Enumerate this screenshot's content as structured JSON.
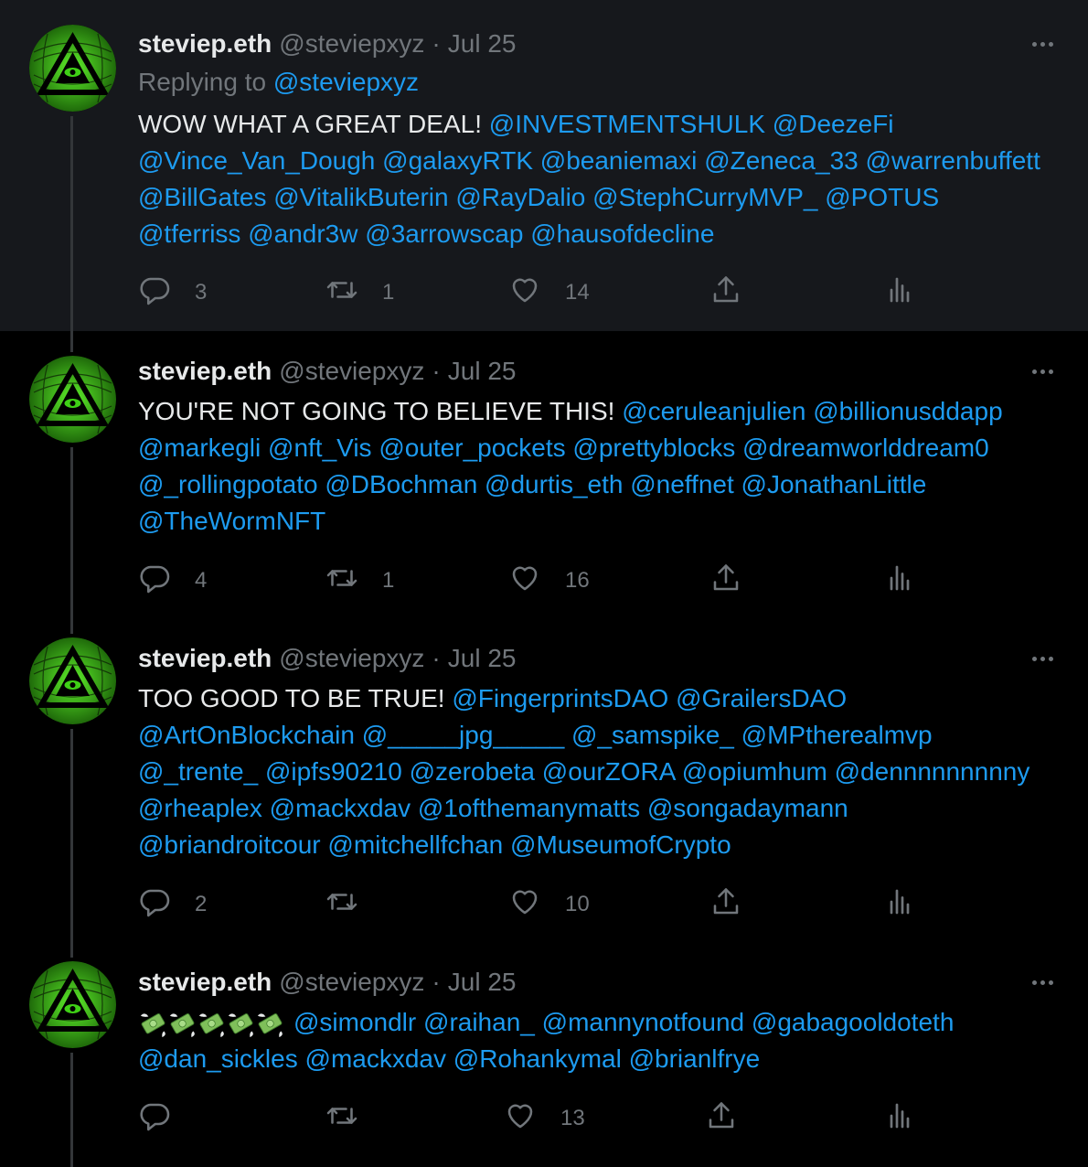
{
  "tweets": [
    {
      "name": "steviep.eth",
      "handle": "@steviepxyz",
      "separator": "·",
      "date": "Jul 25",
      "replying_label": "Replying to",
      "replying_handle": "@steviepxyz",
      "lead": "WOW WHAT A GREAT DEAL!",
      "mentions": [
        "@INVESTMENTSHULK",
        "@DeezeFi",
        "@Vince_Van_Dough",
        "@galaxyRTK",
        "@beaniemaxi",
        "@Zeneca_33",
        "@warrenbuffett",
        "@BillGates",
        "@VitalikButerin",
        "@RayDalio",
        "@StephCurryMVP_",
        "@POTUS",
        "@tferriss",
        "@andr3w",
        "@3arrowscap",
        "@hausofdecline"
      ],
      "lines": [
        [
          "@INVESTMENTSHULK",
          "@DeezeFi"
        ],
        [
          "@Vince_Van_Dough",
          "@galaxyRTK",
          "@beaniemaxi",
          "@Zeneca_33",
          "@warrenbuffett"
        ],
        [
          "@BillGates",
          "@VitalikButerin",
          "@RayDalio",
          "@StephCurryMVP_",
          "@POTUS"
        ],
        [
          "@tferriss",
          "@andr3w",
          "@3arrowscap",
          "@hausofdecline"
        ]
      ],
      "replies": "3",
      "retweets": "1",
      "likes": "14"
    },
    {
      "name": "steviep.eth",
      "handle": "@steviepxyz",
      "separator": "·",
      "date": "Jul 25",
      "lead": "YOU'RE NOT GOING TO BELIEVE THIS!",
      "lines": [
        [
          "@ceruleanjulien",
          "@billionusddapp"
        ],
        [
          "@markegli",
          "@nft_Vis",
          "@outer_pockets",
          "@prettyblocks",
          "@dreamworlddream0"
        ],
        [
          "@_rollingpotato",
          "@DBochman",
          "@durtis_eth",
          "@neffnet",
          "@JonathanLittle"
        ],
        [
          "@TheWormNFT"
        ]
      ],
      "replies": "4",
      "retweets": "1",
      "likes": "16"
    },
    {
      "name": "steviep.eth",
      "handle": "@steviepxyz",
      "separator": "·",
      "date": "Jul 25",
      "lead": "TOO GOOD TO BE TRUE!",
      "lines": [
        [
          "@FingerprintsDAO",
          "@GrailersDAO"
        ],
        [
          "@ArtOnBlockchain",
          "@_____jpg_____",
          "@_samspike_",
          "@MPtherealmvp"
        ],
        [
          "@_trente_",
          "@ipfs90210",
          "@zerobeta",
          "@ourZORA",
          "@opiumhum",
          "@dennnnnnnnny"
        ],
        [
          "@rheaplex",
          "@mackxdav",
          "@1ofthemanymatts",
          "@songadaymann"
        ],
        [
          "@briandroitcour",
          "@mitchellfchan",
          "@MuseumofCrypto"
        ]
      ],
      "replies": "2",
      "retweets": "",
      "likes": "10"
    },
    {
      "name": "steviep.eth",
      "handle": "@steviepxyz",
      "separator": "·",
      "date": "Jul 25",
      "emoji": "money-with-wings",
      "emoji_count": 5,
      "lines": [
        [
          "@simondlr",
          "@raihan_",
          "@mannynotfound",
          "@gabagooldoteth"
        ],
        [
          "@dan_sickles",
          "@mackxdav",
          "@Rohankymal",
          "@brianlfrye"
        ]
      ],
      "replies": "",
      "retweets": "",
      "likes": "13"
    }
  ],
  "icons": {
    "reply": "reply-icon",
    "retweet": "retweet-icon",
    "like": "heart-icon",
    "share": "share-icon",
    "analytics": "analytics-icon",
    "more": "more-options-icon"
  },
  "colors": {
    "background": "#000000",
    "highlight": "#16181c",
    "text": "#e7e9ea",
    "secondary": "#71767b",
    "link": "#1d9bf0",
    "avatar_green": "#3fd016"
  }
}
